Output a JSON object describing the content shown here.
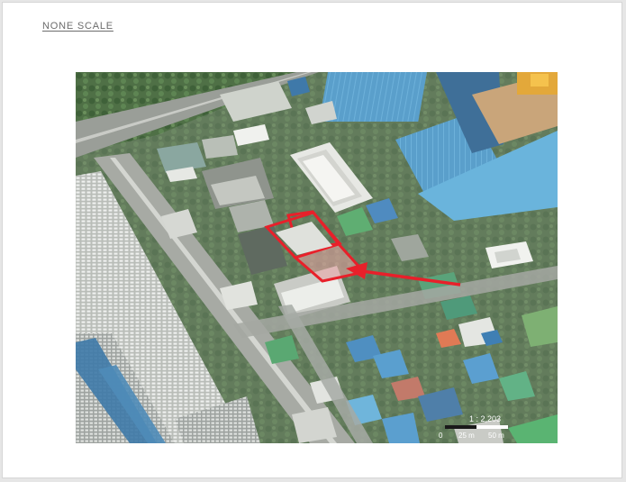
{
  "page": {
    "scale_title": "NONE SCALE"
  },
  "map": {
    "imagery": "satellite",
    "highlight_color": "#e8202a",
    "arrow_color": "#e8202a",
    "scale_bar": {
      "ratio": "1 : 2,203",
      "ticks": [
        "0",
        "25 m",
        "50 m"
      ]
    }
  }
}
